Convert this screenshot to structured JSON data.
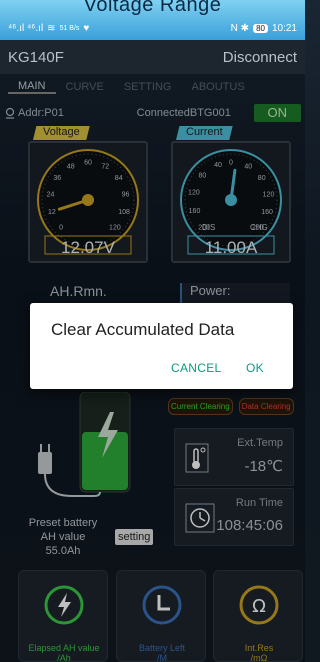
{
  "banner": {
    "title": "Voltage Range"
  },
  "statusbar": {
    "left_icons": "⁴⁶.ıl ⁴⁶.ıl",
    "speed": "51 B/s",
    "right_icons": "N ✱",
    "battery": "80",
    "time": "10:21"
  },
  "appbar": {
    "title": "KG140F",
    "action": "Disconnect"
  },
  "tabs": [
    "MAIN",
    "CURVE",
    "SETTING",
    "ABOUTUS"
  ],
  "status": {
    "addr": "Addr:P01",
    "connection": "ConnectedBTG001",
    "power_toggle": "ON"
  },
  "voltage_gauge": {
    "label": "Voltage",
    "ticks": [
      "0",
      "12",
      "24",
      "36",
      "48",
      "60",
      "72",
      "84",
      "96",
      "108",
      "120"
    ],
    "value": "12.07V",
    "reading": 12.07
  },
  "current_gauge": {
    "label": "Current",
    "ticks_left": [
      "200",
      "160",
      "120",
      "80",
      "40"
    ],
    "ticks_right": [
      "0",
      "40",
      "80",
      "120",
      "160",
      "200"
    ],
    "dis": "DIS",
    "chg": "CHG",
    "value": "11.00A",
    "reading": 11.0
  },
  "ah_remaining": {
    "label": "AH.Rmn."
  },
  "power": {
    "label": "Power:"
  },
  "dialog": {
    "title": "Clear Accumulated Data",
    "cancel": "CANCEL",
    "ok": "OK"
  },
  "clear_buttons": {
    "current": "Current Clearing",
    "data": "Data Clearing"
  },
  "ext_temp": {
    "label": "Ext.Temp",
    "value": "-18℃"
  },
  "run_time": {
    "label": "Run Time",
    "value": "108:45:06"
  },
  "preset": {
    "line1": "Preset battery",
    "line2": "AH value",
    "value": "55.0Ah",
    "setting": "setting"
  },
  "bottom_cards": [
    {
      "label1": "Elapsed AH value",
      "label2": "/Ah"
    },
    {
      "label1": "Battery Left",
      "label2": "/M"
    },
    {
      "label1": "Int.Res",
      "label2": "/mΩ"
    }
  ],
  "colors": {
    "accent_green": "#1e7a2a",
    "voltage_tag": "#d8c040",
    "current_tag": "#4ec0d8",
    "dialog_button": "#0c9a86"
  }
}
